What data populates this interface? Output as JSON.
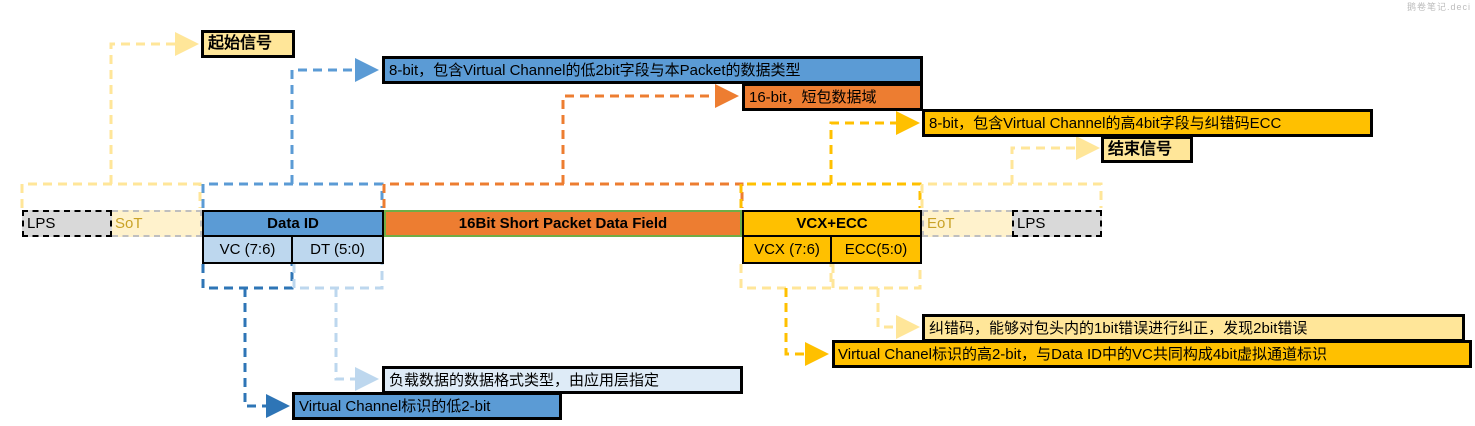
{
  "colors": {
    "blue": "#5b9bd5",
    "light_blue": "#bdd7ee",
    "orange": "#ed7d31",
    "amber": "#ffc000",
    "light_amber": "#ffe699",
    "gray": "#d9d9d9",
    "green_border": "#70ad47"
  },
  "packet": {
    "lps_left": "LPS",
    "sot": "SoT",
    "data_id": "Data ID",
    "data_field": "16Bit Short Packet Data Field",
    "vcx_ecc": "VCX+ECC",
    "eot": "EoT",
    "lps_right": "LPS",
    "vc": "VC (7:6)",
    "dt": "DT (5:0)",
    "vcx": "VCX (7:6)",
    "ecc": "ECC(5:0)"
  },
  "callouts": {
    "start_signal": "起始信号",
    "data_id_desc": "8-bit，包含Virtual Channel的低2bit字段与本Packet的数据类型",
    "short_data_desc": "16-bit，短包数据域",
    "vcx_ecc_desc": "8-bit，包含Virtual Channel的高4bit字段与纠错码ECC",
    "end_signal": "结束信号",
    "ecc_desc": "纠错码，能够对包头内的1bit错误进行纠正，发现2bit错误",
    "vcx_desc": "Virtual Chanel标识的高2-bit，与Data ID中的VC共同构成4bit虚拟通道标识",
    "dt_desc": "负载数据的数据格式类型，由应用层指定",
    "vc_desc": "Virtual Channel标识的低2-bit"
  },
  "watermark": "鹅卷笔记.deci"
}
